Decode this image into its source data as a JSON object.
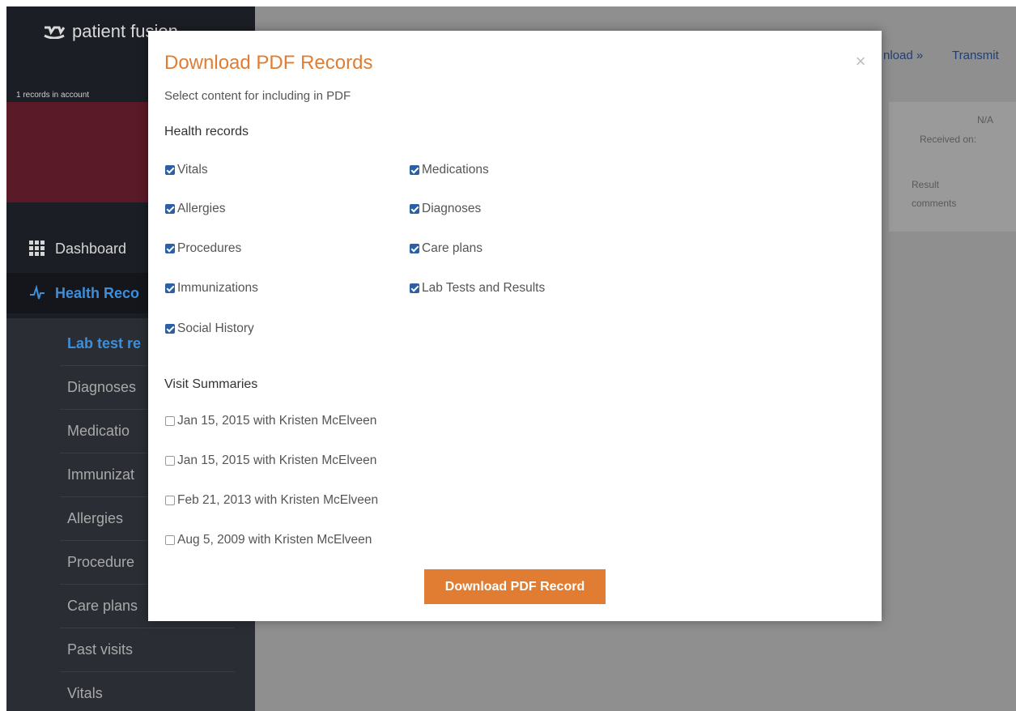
{
  "app": {
    "logo_text": "patient fusion",
    "records_count": "1 records in account",
    "nav": {
      "dashboard": "Dashboard",
      "health_records": "Health Reco"
    },
    "subnav": [
      {
        "label": "Lab test re",
        "active": true
      },
      {
        "label": "Diagnoses",
        "active": false
      },
      {
        "label": "Medicatio",
        "active": false
      },
      {
        "label": "Immunizat",
        "active": false
      },
      {
        "label": "Allergies",
        "active": false
      },
      {
        "label": "Procedure",
        "active": false
      },
      {
        "label": "Care plans",
        "active": false
      },
      {
        "label": "Past visits",
        "active": false
      },
      {
        "label": "Vitals",
        "active": false
      }
    ],
    "header_links": {
      "download": "nload »",
      "transmit": "Transmit"
    },
    "table": {
      "na": "N/A",
      "received_on": "Received on:",
      "result_comments_1": "Result",
      "result_comments_2": "comments"
    },
    "colors": {
      "accent_orange": "#e07d33",
      "sidebar_bg": "#1b1e24",
      "link_blue": "#3d8fd9",
      "checkbox_blue": "#2b5fa6"
    }
  },
  "modal": {
    "title": "Download PDF Records",
    "close_icon": "×",
    "subtitle": "Select content for including in PDF",
    "health_records_heading": "Health records",
    "health_records": [
      {
        "label": "Vitals",
        "checked": true
      },
      {
        "label": "Medications",
        "checked": true
      },
      {
        "label": "Allergies",
        "checked": true
      },
      {
        "label": "Diagnoses",
        "checked": true
      },
      {
        "label": "Procedures",
        "checked": true
      },
      {
        "label": "Care plans",
        "checked": true
      },
      {
        "label": "Immunizations",
        "checked": true
      },
      {
        "label": "Lab Tests and Results",
        "checked": true
      },
      {
        "label": "Social History",
        "checked": true
      }
    ],
    "visit_summaries_heading": "Visit Summaries",
    "visit_summaries": [
      {
        "label": "Jan 15, 2015 with Kristen McElveen",
        "checked": false
      },
      {
        "label": "Jan 15, 2015 with Kristen McElveen",
        "checked": false
      },
      {
        "label": "Feb 21, 2013 with Kristen McElveen",
        "checked": false
      },
      {
        "label": "Aug 5, 2009 with Kristen McElveen",
        "checked": false
      }
    ],
    "download_button": "Download PDF Record"
  }
}
